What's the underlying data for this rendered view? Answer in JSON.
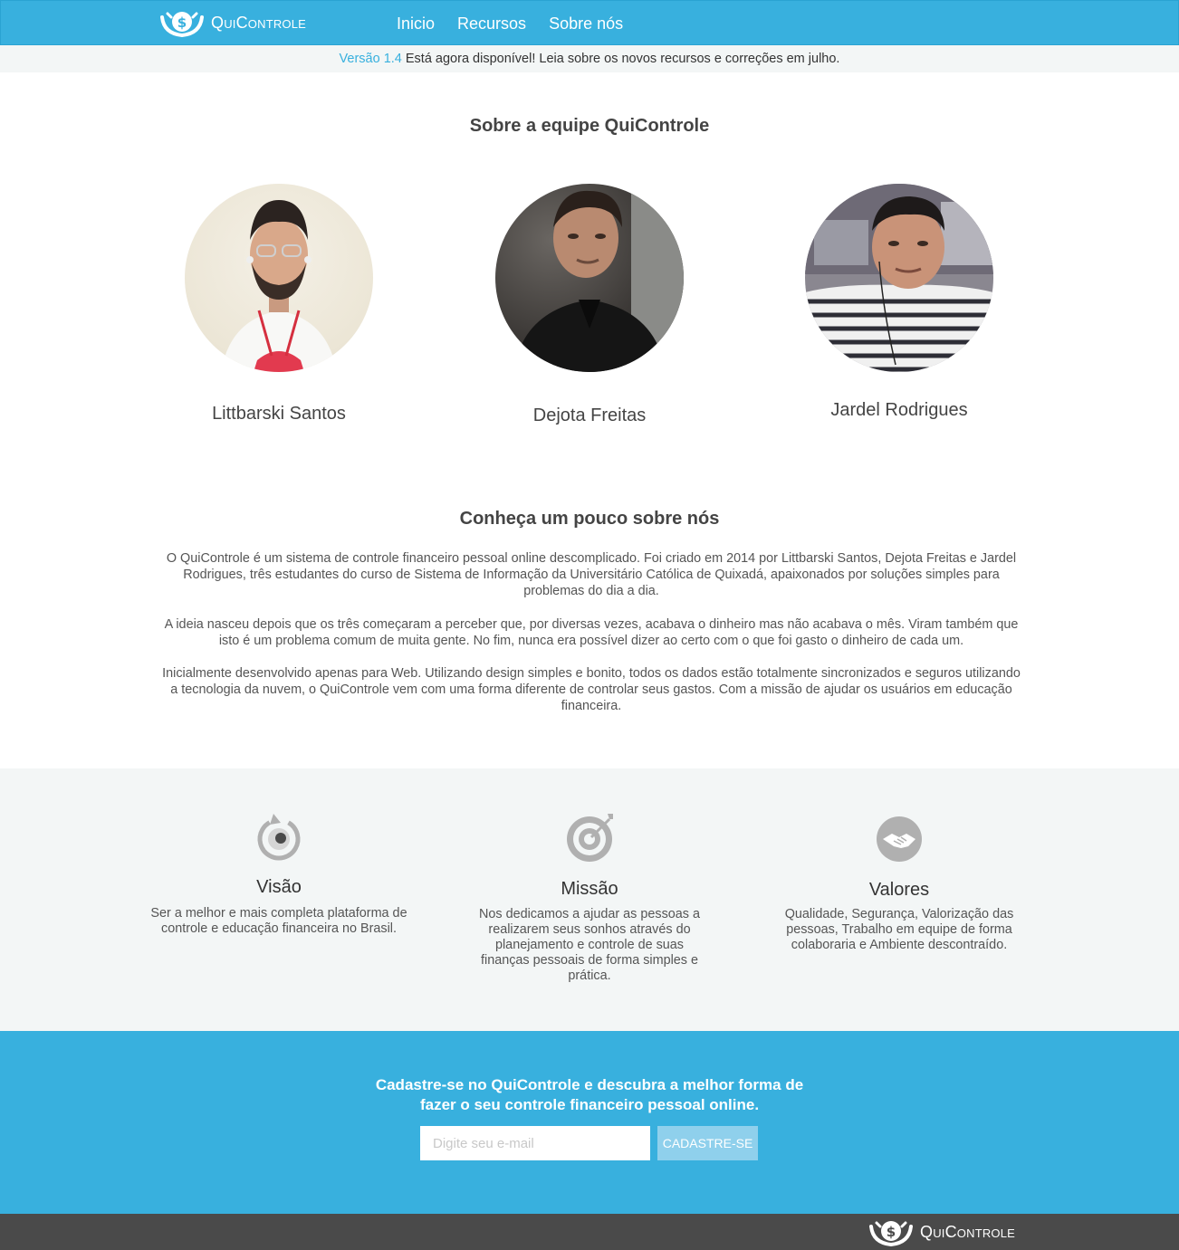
{
  "brand": {
    "name": "QuiControle"
  },
  "nav": {
    "items": [
      {
        "label": "Inicio"
      },
      {
        "label": "Recursos"
      },
      {
        "label": "Sobre nós"
      }
    ]
  },
  "announcement": {
    "version_link": "Versão 1.4",
    "text": "Está agora disponível! Leia sobre os novos recursos e correções em julho."
  },
  "team": {
    "title": "Sobre a equipe QuiControle",
    "members": [
      {
        "name": "Littbarski Santos"
      },
      {
        "name": "Dejota Freitas"
      },
      {
        "name": "Jardel Rodrigues"
      }
    ]
  },
  "about": {
    "title": "Conheça um pouco sobre nós",
    "paragraphs": [
      "O QuiControle é um sistema de controle financeiro pessoal online descomplicado. Foi criado em 2014 por Littbarski Santos, Dejota Freitas e Jardel Rodrigues, três estudantes do curso de Sistema de Informação da Universitário Católica de Quixadá, apaixonados por soluções simples para problemas do dia a dia.",
      "A ideia nasceu depois que os três começaram a perceber que, por diversas vezes, acabava o dinheiro mas não acabava o mês. Viram também que isto é um problema comum de muita gente. No fim, nunca era possível dizer ao certo com o que foi gasto o dinheiro de cada um.",
      "Inicialmente desenvolvido apenas para Web. Utilizando design simples e bonito, todos os dados estão totalmente sincronizados e seguros utilizando a tecnologia da nuvem, o QuiControle vem com uma forma diferente de controlar seus gastos. Com a missão de ajudar os usuários em educação financeira."
    ]
  },
  "features": [
    {
      "icon": "eye-refresh-icon",
      "title": "Visão",
      "text": "Ser a melhor e mais completa plataforma de controle e educação financeira no Brasil."
    },
    {
      "icon": "target-icon",
      "title": "Missão",
      "text": "Nos dedicamos a ajudar as pessoas a realizarem seus sonhos através do planejamento e controle de suas finanças pessoais de forma simples e prática."
    },
    {
      "icon": "handshake-icon",
      "title": "Valores",
      "text": "Qualidade, Segurança, Valorização das pessoas, Trabalho em equipe de forma colaboraria e Ambiente descontraído."
    }
  ],
  "signup": {
    "title": "Cadastre-se no QuiControle e descubra a melhor forma de fazer o seu controle financeiro pessoal online.",
    "email_placeholder": "Digite seu e-mail",
    "button_label": "CADASTRE-SE"
  },
  "colors": {
    "accent": "#38b0de",
    "footer": "#4a4a4a",
    "light_bg": "#f3f6f6"
  }
}
